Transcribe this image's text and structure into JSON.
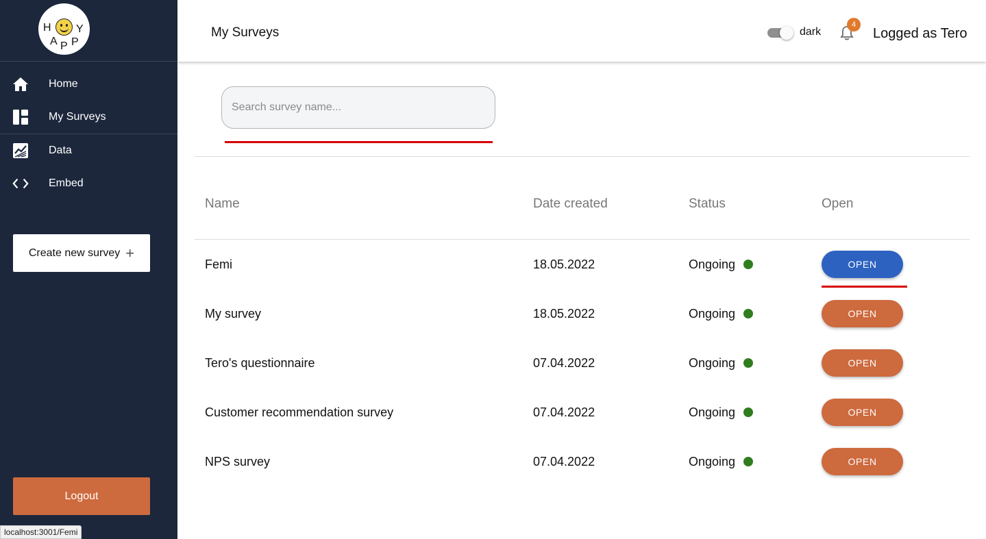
{
  "logo": {
    "letters": [
      "H",
      "Y",
      "A",
      "P",
      "P"
    ]
  },
  "sidebar": {
    "items": [
      {
        "label": "Home",
        "icon": "home-icon"
      },
      {
        "label": "My Surveys",
        "icon": "dashboard-icon"
      },
      {
        "label": "Data",
        "icon": "chart-icon"
      },
      {
        "label": "Embed",
        "icon": "code-icon"
      }
    ],
    "create_label": "Create new survey",
    "logout_label": "Logout"
  },
  "status_bar": {
    "url": "localhost:3001/Femi"
  },
  "header": {
    "title": "My Surveys",
    "dark_label": "dark",
    "notification_count": "4",
    "user_label": "Logged as Tero"
  },
  "search": {
    "placeholder": "Search survey name...",
    "value": ""
  },
  "table": {
    "headers": {
      "name": "Name",
      "date": "Date created",
      "status": "Status",
      "open": "Open"
    },
    "rows": [
      {
        "name": "Femi",
        "date": "18.05.2022",
        "status": "Ongoing",
        "open": "OPEN"
      },
      {
        "name": "My survey",
        "date": "18.05.2022",
        "status": "Ongoing",
        "open": "OPEN"
      },
      {
        "name": "Tero's questionnaire",
        "date": "07.04.2022",
        "status": "Ongoing",
        "open": "OPEN"
      },
      {
        "name": "Customer recommendation survey",
        "date": "07.04.2022",
        "status": "Ongoing",
        "open": "OPEN"
      },
      {
        "name": "NPS survey",
        "date": "07.04.2022",
        "status": "Ongoing",
        "open": "OPEN"
      }
    ]
  },
  "colors": {
    "sidebar_bg": "#1c273c",
    "accent_orange": "#cd6a3e",
    "active_blue": "#2d62c1",
    "status_green": "#2f7d1f",
    "underline_red": "#d70000"
  }
}
